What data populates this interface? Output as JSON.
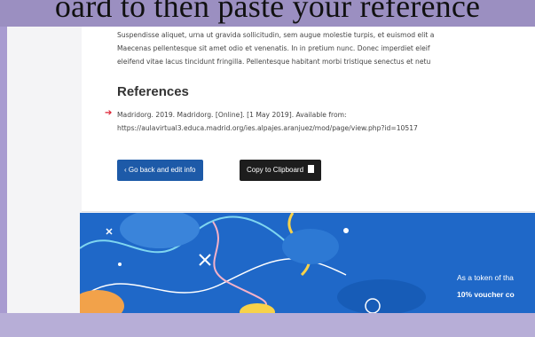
{
  "slide": {
    "caption": "oard to then paste your reference"
  },
  "article": {
    "paragraph_lines": [
      "Suspendisse aliquet, urna ut gravida sollicitudin, sem augue molestie turpis, et euismod elit a",
      "Maecenas pellentesque sit amet odio et venenatis. In in pretium nunc. Donec imperdiet eleif",
      "eleifend vitae lacus tincidunt fringilla. Pellentesque habitant morbi tristique senectus et netu"
    ],
    "references_heading": "References",
    "reference_lines": [
      "Madridorg. 2019. Madridorg. [Online]. [1 May 2019]. Available from:",
      "https://aulavirtual3.educa.madrid.org/ies.alpajes.aranjuez/mod/page/view.php?id=10517"
    ]
  },
  "actions": {
    "back_label": "‹ Go back and edit info",
    "copy_label": "Copy to Clipboard"
  },
  "banner": {
    "line1": "As a token of tha",
    "line2": "10% voucher co"
  },
  "colors": {
    "back_button": "#1d5aa8",
    "copy_button": "#1d1d1d",
    "banner_bg": "#1f68c8",
    "slide_bg": "#9b8fc1",
    "arrow": "#dd2233"
  }
}
